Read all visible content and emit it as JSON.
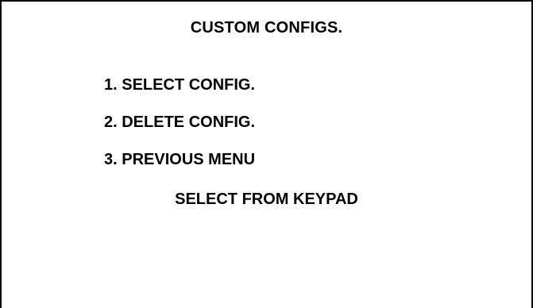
{
  "screen": {
    "title": "CUSTOM CONFIGS.",
    "menu_items": [
      {
        "label": "1. SELECT CONFIG."
      },
      {
        "label": "2. DELETE CONFIG."
      },
      {
        "label": "3. PREVIOUS MENU"
      }
    ],
    "prompt": "SELECT FROM KEYPAD"
  }
}
